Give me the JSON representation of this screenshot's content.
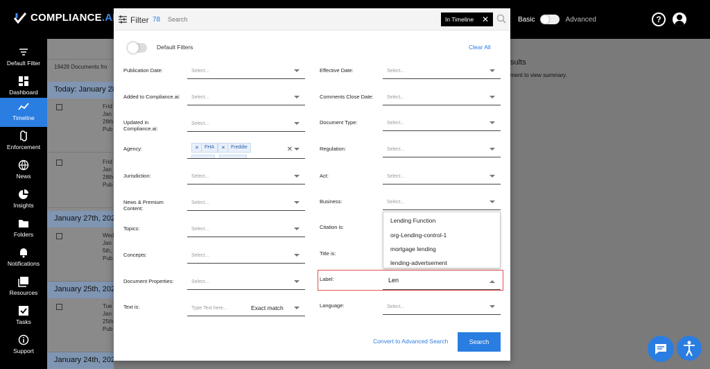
{
  "brand": {
    "name": "COMPLIANCE",
    "suffix": ".AI"
  },
  "header": {
    "mode_basic": "Basic",
    "mode_advanced": "Advanced"
  },
  "sidebar": {
    "items": [
      {
        "label": "Default Filter",
        "icon": "filter-lines-icon"
      },
      {
        "label": "Dashboard",
        "icon": "dashboard-icon"
      },
      {
        "label": "Timeline",
        "icon": "timeline-icon",
        "active": true
      },
      {
        "label": "Enforcement",
        "icon": "enforcement-icon"
      },
      {
        "label": "News",
        "icon": "globe-icon"
      },
      {
        "label": "Insights",
        "icon": "pie-chart-icon"
      },
      {
        "label": "Folders",
        "icon": "folder-icon"
      },
      {
        "label": "Notifications",
        "icon": "bell-icon"
      },
      {
        "label": "Resources",
        "icon": "book-icon"
      },
      {
        "label": "Tasks",
        "icon": "checkbox-icon"
      },
      {
        "label": "Support",
        "icon": "info-icon"
      }
    ]
  },
  "background": {
    "doc_count": "19428 Documents fro",
    "dates": [
      "Today: January 28",
      "January 27th, 202",
      "January 25th, 202",
      "January 24th, 2022"
    ],
    "rows": [
      [
        "Frid",
        "Jan",
        "28th",
        "Pub"
      ],
      [
        "Frid",
        "Jan",
        "28th",
        "Pub"
      ],
      [
        "Wed",
        "Jan",
        "5th,",
        "Pub"
      ],
      [
        "Tue",
        "Jan",
        "25th",
        "Pub"
      ]
    ],
    "right_title": "sults",
    "right_sub": "ment to view summary."
  },
  "filter": {
    "title": "Filter",
    "count": "78",
    "search_placeholder": "Search",
    "timeline_chip": "In Timeline",
    "default_filters": "Default Filters",
    "clear_all": "Clear All",
    "select_placeholder": "Select...",
    "left_fields": [
      "Publication Date:",
      "Added to Compliance.ai:",
      "Updated in Compliance.ai:",
      "Agency:",
      "Jurisdiction:",
      "News & Premium Content:",
      "Topics:",
      "Concepts:",
      "Document Properties:",
      "Text is:"
    ],
    "right_fields": [
      "Effective Date:",
      "Comments Close Date:",
      "Document Type:",
      "Regulation:",
      "Act:",
      "Business:",
      "Citation is:",
      "Title is:",
      "Label:",
      "Language:"
    ],
    "agency_chips": [
      "FHA",
      "Freddie"
    ],
    "text_placeholder": "Type Text here...",
    "match_mode": "Exact match",
    "label_input": "Len",
    "label_options": [
      "Lending Function",
      "org-Lending-control-1",
      "mortgage lending",
      "lending-advertsement"
    ],
    "convert_link": "Convert to Advanced Search",
    "search_button": "Search"
  },
  "colors": {
    "accent": "#2a7de1",
    "highlight": "#e0504a"
  }
}
